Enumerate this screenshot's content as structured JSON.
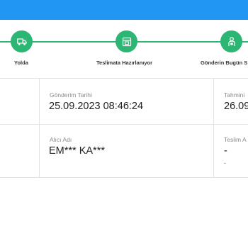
{
  "colors": {
    "header_blue": "#2196f3",
    "step_green": "#2bb673",
    "divider": "#e3e3e3"
  },
  "tracker": {
    "steps": [
      {
        "label": "Yolda",
        "icon": "truck-icon"
      },
      {
        "label": "Teslimata Hazırlanıyor",
        "icon": "package-box-icon"
      },
      {
        "label": "Gönderin Bugün S",
        "icon": "courier-person-icon"
      }
    ]
  },
  "details": {
    "shipment_date": {
      "label": "Gönderim Tarihi",
      "value": "25.09.2023 08:46:24"
    },
    "estimated": {
      "label": "Tahmini",
      "value": "26.09"
    },
    "recipient": {
      "label": "Alıcı Adı",
      "value": "EM*** KA***"
    },
    "delivery": {
      "label": "Teslim A",
      "value": "-",
      "sub": "-"
    }
  }
}
